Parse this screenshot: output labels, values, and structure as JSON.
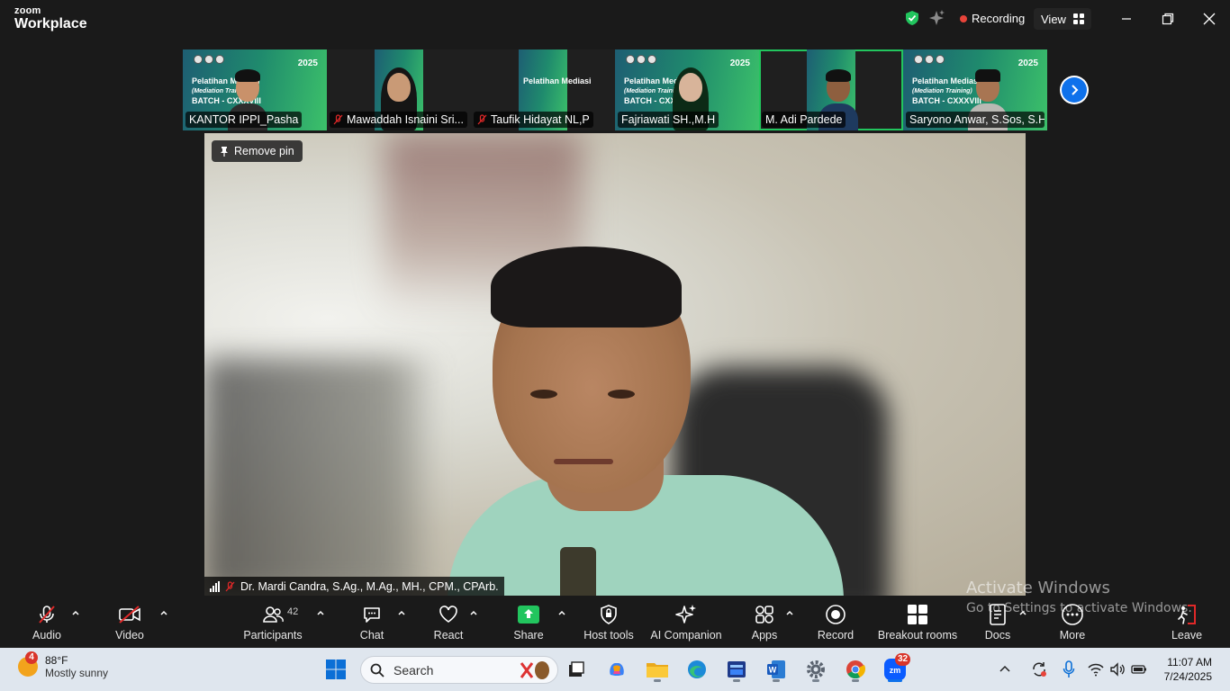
{
  "app": {
    "brand_top": "zoom",
    "brand_bottom": "Workplace"
  },
  "header": {
    "recording_label": "Recording",
    "view_label": "View",
    "icons": [
      "shield-check-icon",
      "sparkle-icon",
      "minimize-icon",
      "restore-icon",
      "close-icon"
    ]
  },
  "thumbnails": [
    {
      "name": "KANTOR IPPI_Pasha",
      "muted": false,
      "active": false
    },
    {
      "name": "Mawaddah Isnaini Sri...",
      "muted": true,
      "active": false
    },
    {
      "name": "Taufik Hidayat NL,P",
      "muted": true,
      "active": false
    },
    {
      "name": "Fajriawati SH.,M.H",
      "muted": false,
      "active": false
    },
    {
      "name": "M. Adi Pardede",
      "muted": false,
      "active": true
    },
    {
      "name": "Saryono Anwar, S.Sos, S.H",
      "muted": false,
      "active": false
    }
  ],
  "banner": {
    "year": "2025",
    "title_1": "Pelatihan Mediasi",
    "title_2": "(Mediation Training)",
    "batch": "BATCH - CXXXVIII"
  },
  "main": {
    "remove_pin_label": "Remove pin",
    "speaker_name": "Dr. Mardi Candra, S.Ag., M.Ag., MH., CPM., CPArb."
  },
  "watermark": {
    "line1": "Activate Windows",
    "line2": "Go to Settings to activate Windows."
  },
  "toolbar": {
    "audio": "Audio",
    "video": "Video",
    "participants": "Participants",
    "participants_count": "42",
    "chat": "Chat",
    "react": "React",
    "share": "Share",
    "host_tools": "Host tools",
    "ai_companion": "AI Companion",
    "apps": "Apps",
    "record": "Record",
    "breakout_rooms": "Breakout rooms",
    "docs": "Docs",
    "more": "More",
    "leave": "Leave"
  },
  "taskbar": {
    "weather_badge": "4",
    "temperature": "88°F",
    "condition": "Mostly sunny",
    "search_placeholder": "Search",
    "zoom_badge": "32",
    "time": "11:07 AM",
    "date": "7/24/2025"
  },
  "colors": {
    "accent_blue": "#0e71eb",
    "active_green": "#22c55e",
    "share_green": "#22c55e",
    "record_red": "#e8443a",
    "leave_red": "#e02828"
  }
}
